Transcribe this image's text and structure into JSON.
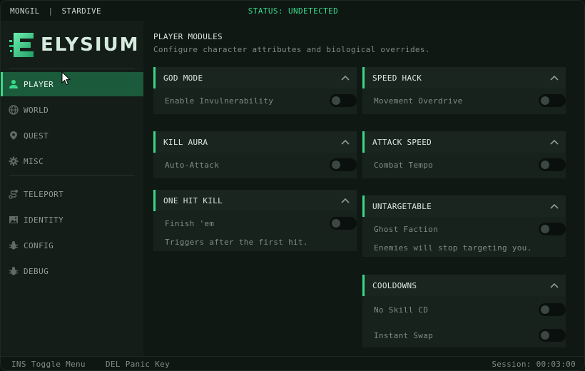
{
  "titlebar": {
    "user": "MONGIL",
    "separator": "|",
    "server": "STARDIVE",
    "status": "STATUS: UNDETECTED"
  },
  "brand": {
    "name": "ELYSIUM",
    "accent": "#39d98a"
  },
  "sidebar": {
    "items": [
      {
        "label": "PLAYER",
        "icon": "user-icon",
        "active": true
      },
      {
        "label": "WORLD",
        "icon": "globe-icon",
        "active": false
      },
      {
        "label": "QUEST",
        "icon": "map-pin-icon",
        "active": false
      },
      {
        "label": "MISC",
        "icon": "gear-icon",
        "active": false
      },
      {
        "label": "TELEPORT",
        "icon": "route-icon",
        "active": false
      },
      {
        "label": "IDENTITY",
        "icon": "image-icon",
        "active": false
      },
      {
        "label": "CONFIG",
        "icon": "bug-icon",
        "active": false
      },
      {
        "label": "DEBUG",
        "icon": "bug-icon",
        "active": false
      }
    ]
  },
  "main": {
    "title": "PLAYER MODULES",
    "subtitle": "Configure character attributes and biological overrides.",
    "cards": [
      {
        "title": "GOD MODE",
        "rows": [
          {
            "label": "Enable Invulnerability",
            "enabled": false
          }
        ],
        "note": ""
      },
      {
        "title": "KILL AURA",
        "rows": [
          {
            "label": "Auto-Attack",
            "enabled": false
          }
        ],
        "note": ""
      },
      {
        "title": "ONE HIT KILL",
        "rows": [
          {
            "label": "Finish 'em",
            "enabled": false
          }
        ],
        "note": "Triggers after the first hit."
      },
      {
        "title": "SPEED HACK",
        "rows": [
          {
            "label": "Movement Overdrive",
            "enabled": false
          }
        ],
        "note": ""
      },
      {
        "title": "ATTACK SPEED",
        "rows": [
          {
            "label": "Combat Tempo",
            "enabled": false
          }
        ],
        "note": ""
      },
      {
        "title": "UNTARGETABLE",
        "rows": [
          {
            "label": "Ghost Faction",
            "enabled": false
          }
        ],
        "note": "Enemies will stop targeting you."
      },
      {
        "title": "COOLDOWNS",
        "rows": [
          {
            "label": "No Skill CD",
            "enabled": false
          },
          {
            "label": "Instant Swap",
            "enabled": false
          }
        ],
        "note": ""
      }
    ]
  },
  "footer": {
    "toggle_hint": "INS Toggle Menu",
    "panic_hint": "DEL Panic Key",
    "session": "Session: 00:03:00"
  }
}
